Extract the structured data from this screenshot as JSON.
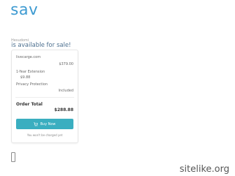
{
  "header": {
    "logo_text": "sav"
  },
  "intro": {
    "pre_heading": "Hesudomi",
    "headline": "is available for sale!"
  },
  "order": {
    "domain": "livecarge.com",
    "domain_price": "$379.00",
    "extension_label": "1-Year Extension",
    "extension_price": "$9.88",
    "privacy_label": "Privacy Protection",
    "privacy_value": "Included",
    "total_label": "Order Total",
    "total_value": "$288.88",
    "buy_label": "Buy Now",
    "note": "You won't be charged yet"
  },
  "watermark": "sitelike.org",
  "colors": {
    "brand": "#3d9ad1",
    "button": "#3aaec0"
  }
}
